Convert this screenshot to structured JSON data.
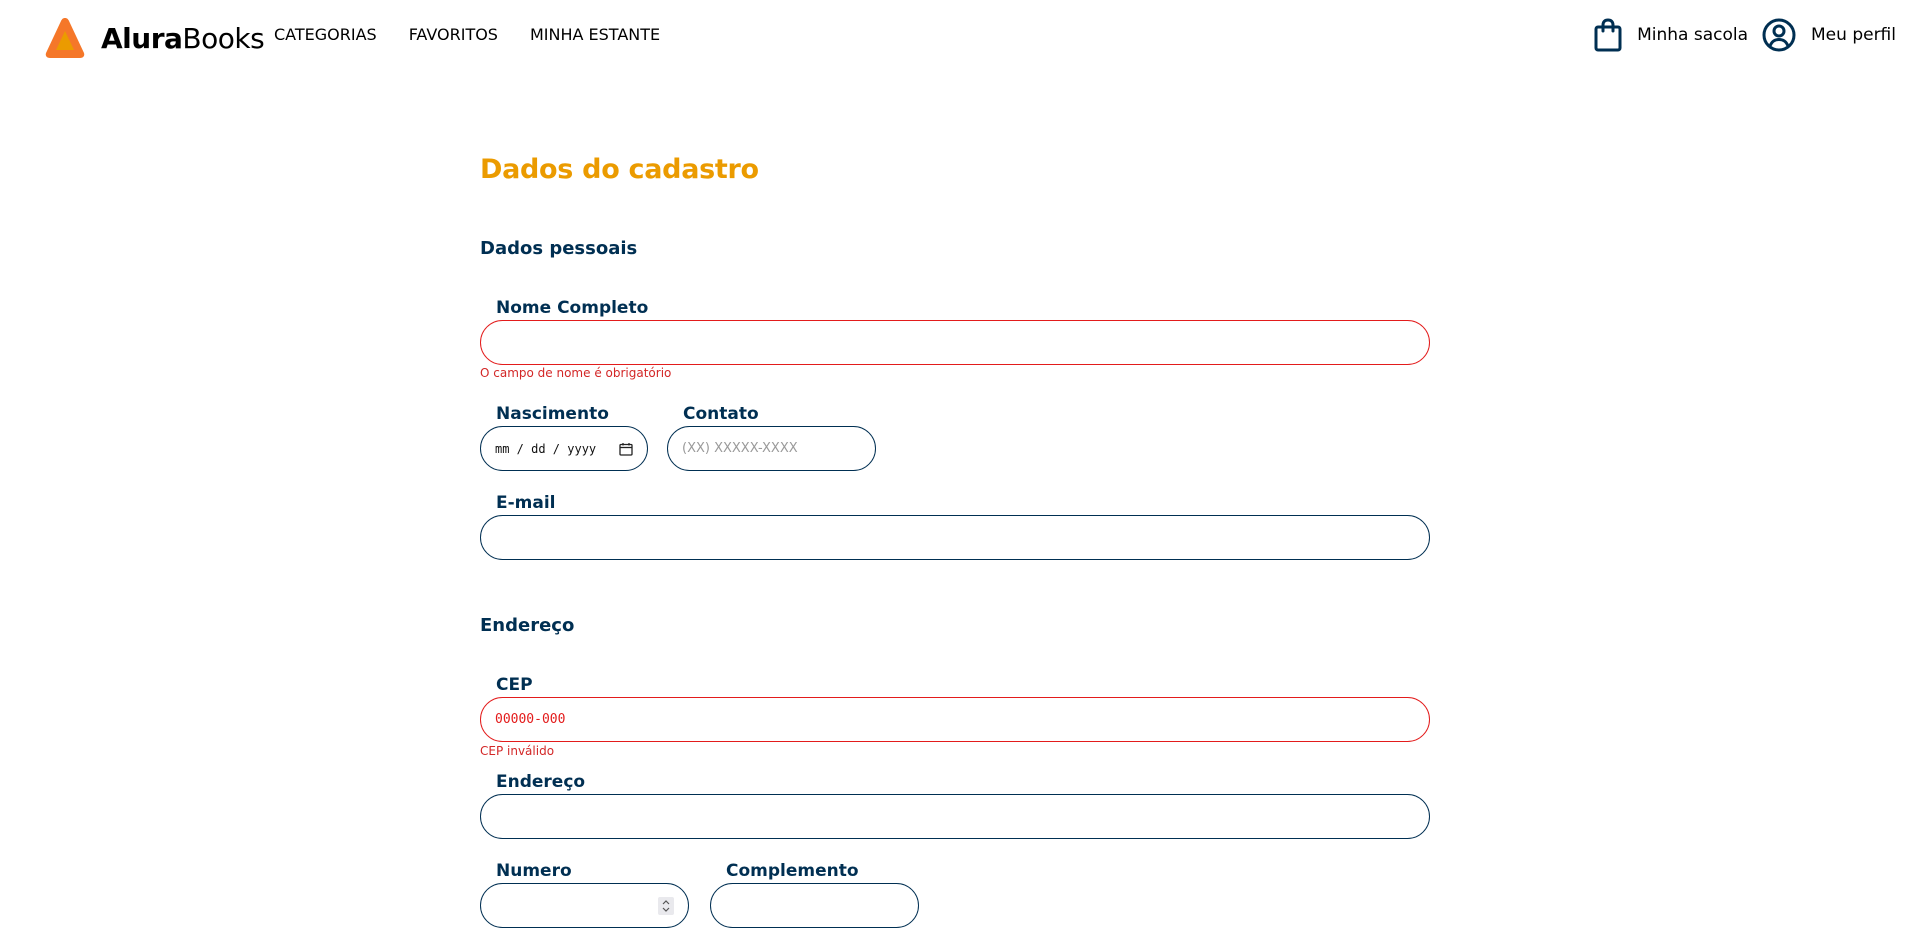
{
  "brand": {
    "name_bold": "Alura",
    "name_light": "Books",
    "logo_outer_color": "#f57729",
    "logo_inner_color": "#eb9b00"
  },
  "nav": {
    "items": [
      {
        "label": "CATEGORIAS"
      },
      {
        "label": "FAVORITOS"
      },
      {
        "label": "MINHA ESTANTE"
      }
    ]
  },
  "header_actions": {
    "bag_label": "Minha sacola",
    "bag_icon": "shopping-bag-icon",
    "profile_label": "Meu perfil",
    "profile_icon": "user-circle-icon"
  },
  "form": {
    "title": "Dados do cadastro",
    "personal_section": "Dados pessoais",
    "name": {
      "label": "Nome Completo",
      "value": "",
      "error": "O campo de nome é obrigatório"
    },
    "birth": {
      "label": "Nascimento",
      "placeholder": "mm / dd / yyyy"
    },
    "contact": {
      "label": "Contato",
      "placeholder": "(XX) XXXXX-XXXX"
    },
    "email": {
      "label": "E-mail",
      "value": ""
    },
    "address_section": "Endereço",
    "cep": {
      "label": "CEP",
      "value": "00000-000",
      "error": "CEP inválido"
    },
    "address": {
      "label": "Endereço",
      "value": ""
    },
    "number": {
      "label": "Numero",
      "value": ""
    },
    "complement": {
      "label": "Complemento",
      "value": ""
    }
  },
  "colors": {
    "title": "#eb9b00",
    "navy": "#002f52",
    "error": "#e31b1b"
  }
}
